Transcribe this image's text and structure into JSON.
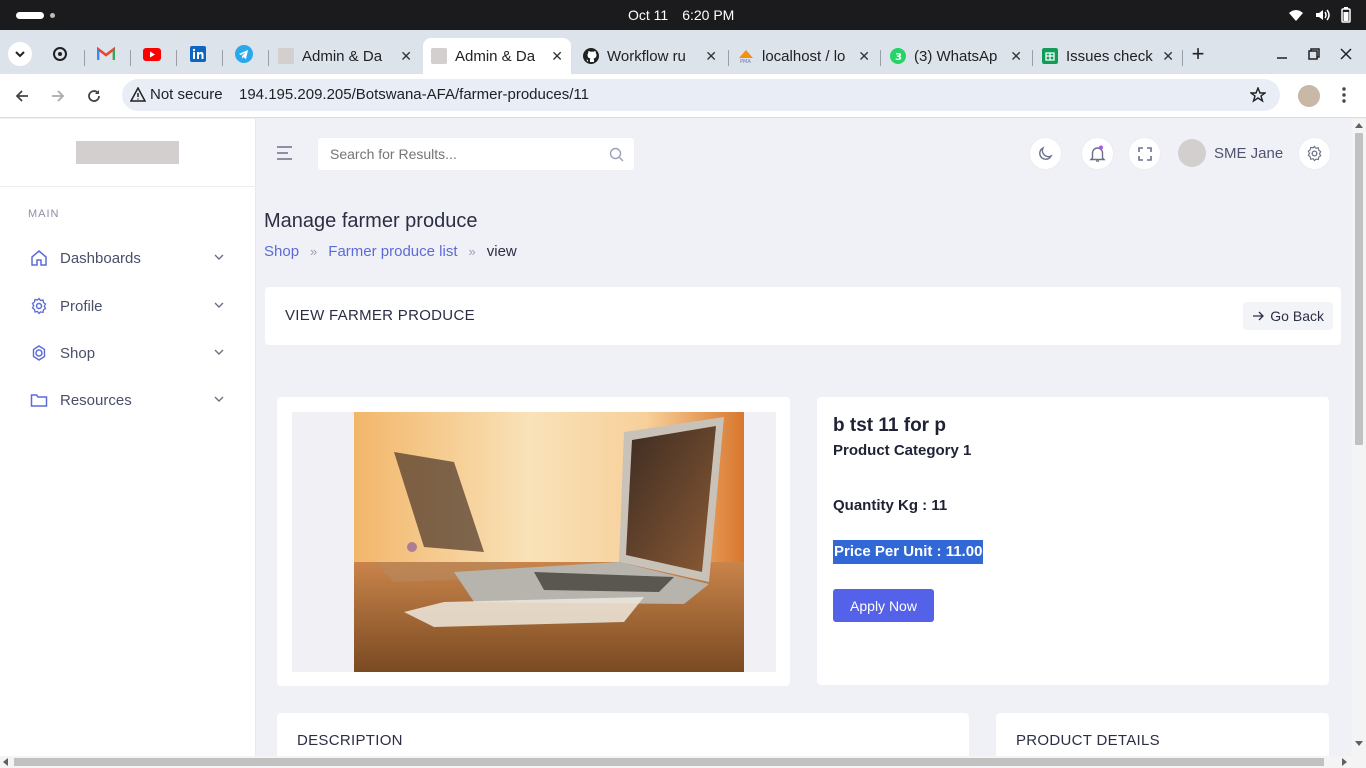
{
  "system": {
    "date": "Oct 11",
    "time": "6:20 PM"
  },
  "tabs": [
    {
      "title": "Admin & Da",
      "active": false
    },
    {
      "title": "Admin & Da",
      "active": true
    },
    {
      "title": "Workflow ru",
      "active": false
    },
    {
      "title": "localhost / lo",
      "active": false
    },
    {
      "title": "(3) WhatsAp",
      "active": false
    },
    {
      "title": "Issues check",
      "active": false
    }
  ],
  "pinned_tabs": [
    "chatgpt-icon",
    "gmail-icon",
    "youtube-icon",
    "linkedin-icon",
    "telegram-icon"
  ],
  "address_bar": {
    "security": "Not secure",
    "url": "194.195.209.205/Botswana-AFA/farmer-produces/11"
  },
  "sidebar": {
    "section": "MAIN",
    "items": [
      {
        "label": "Dashboards",
        "icon": "home-icon"
      },
      {
        "label": "Profile",
        "icon": "gear-icon"
      },
      {
        "label": "Shop",
        "icon": "cog-badge-icon"
      },
      {
        "label": "Resources",
        "icon": "folder-icon"
      }
    ]
  },
  "header": {
    "search_placeholder": "Search for Results...",
    "user_name": "SME Jane"
  },
  "page": {
    "title": "Manage farmer produce",
    "breadcrumb": [
      "Shop",
      "Farmer produce list",
      "view"
    ],
    "card_title": "VIEW FARMER PRODUCE",
    "go_back": "Go Back"
  },
  "product": {
    "name": "b tst 11 for p",
    "category": "Product Category 1",
    "quantity": "Quantity Kg : 11",
    "price": "Price Per Unit : 11.00",
    "apply_label": "Apply Now"
  },
  "sections": {
    "description": "DESCRIPTION",
    "details": "PRODUCT DETAILS"
  },
  "colors": {
    "accent": "#5362e8",
    "link": "#5c6bd6",
    "selection": "#3267d6"
  }
}
